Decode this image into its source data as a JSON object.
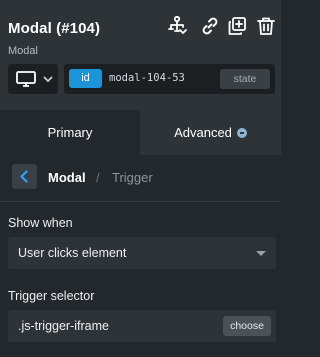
{
  "header": {
    "title": "Modal (#104)",
    "subtitle": "Modal",
    "icons": [
      "structure-icon",
      "link-icon",
      "duplicate-icon",
      "trash-icon"
    ]
  },
  "controls": {
    "device_icon": "monitor-icon",
    "id_badge": "id",
    "id_value": "modal-104-53",
    "state_label": "state"
  },
  "tabs": [
    {
      "label": "Primary",
      "active": true
    },
    {
      "label": "Advanced",
      "active": false
    }
  ],
  "breadcrumb": {
    "current": "Modal",
    "separator": "/",
    "last": "Trigger"
  },
  "fields": {
    "show_when": {
      "label": "Show when",
      "value": "User clicks element"
    },
    "trigger_selector": {
      "label": "Trigger selector",
      "value": ".js-trigger-iframe",
      "button_label": "choose"
    }
  },
  "colors": {
    "accent": "#1e94d8",
    "panel_bg": "#23282d",
    "header_bg": "#2e3337"
  }
}
